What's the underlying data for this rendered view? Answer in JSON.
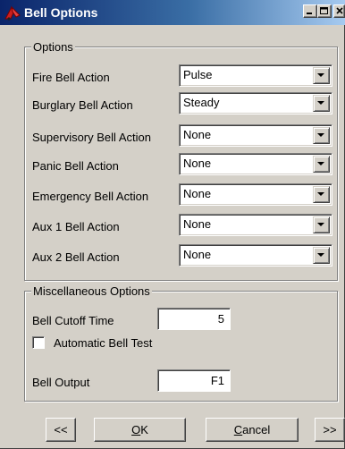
{
  "window": {
    "title": "Bell Options",
    "minimize_label": "_",
    "maximize_label": "□",
    "close_label": "×"
  },
  "options_group": {
    "legend": "Options",
    "rows": [
      {
        "label": "Fire Bell Action",
        "value": "Pulse"
      },
      {
        "label": "Burglary Bell Action",
        "value": "Steady"
      },
      {
        "label": "Supervisory Bell Action",
        "value": "None"
      },
      {
        "label": "Panic Bell Action",
        "value": "None"
      },
      {
        "label": "Emergency Bell Action",
        "value": "None"
      },
      {
        "label": "Aux 1 Bell Action",
        "value": "None"
      },
      {
        "label": "Aux 2 Bell Action",
        "value": "None"
      }
    ]
  },
  "misc_group": {
    "legend": "Miscellaneous Options",
    "bell_cutoff_label": "Bell Cutoff Time",
    "bell_cutoff_value": "5",
    "auto_test_label": "Automatic Bell Test",
    "auto_test_checked": false,
    "bell_output_label": "Bell Output",
    "bell_output_value": "F1"
  },
  "buttons": {
    "prev_label": "<<",
    "ok_mnemonic": "O",
    "ok_rest": "K",
    "cancel_mnemonic": "C",
    "cancel_rest": "ancel",
    "next_label": ">>"
  },
  "colors": {
    "title_bar_start": "#0a246a",
    "title_bar_end": "#a6caf0",
    "dialog_face": "#d4d0c8",
    "icon_red": "#cc1f1f"
  }
}
